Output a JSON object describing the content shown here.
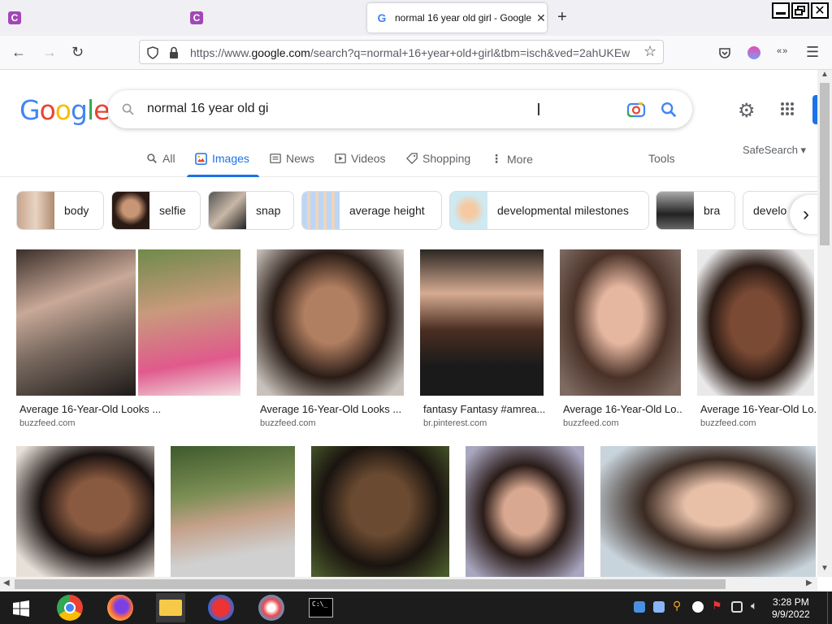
{
  "browser": {
    "tabs": [
      {
        "favicon": "C",
        "title": ""
      },
      {
        "favicon": "C",
        "title": ""
      },
      {
        "favicon": "G",
        "title": "normal 16 year old girl - Google"
      }
    ],
    "url_prefix": "https://www.",
    "url_domain": "google.com",
    "url_rest": "/search?q=normal+16+year+old+girl&tbm=isch&ved=2ahUKEw"
  },
  "google": {
    "logo": [
      "G",
      "o",
      "o",
      "g",
      "l",
      "e"
    ],
    "logo_colors": [
      "#4285f4",
      "#ea4335",
      "#fbbc05",
      "#4285f4",
      "#34a853",
      "#ea4335"
    ],
    "query": "normal 16 year old gi",
    "tabs": [
      "All",
      "Images",
      "News",
      "Videos",
      "Shopping",
      "More"
    ],
    "tools": "Tools",
    "safesearch": "SafeSearch",
    "chips": [
      "body",
      "selfie",
      "snap",
      "average height",
      "developmental milestones",
      "bra",
      "develo"
    ],
    "results": [
      {
        "caption": "Average 16-Year-Old Looks ...",
        "source": "buzzfeed.com"
      },
      {
        "caption": "Average 16-Year-Old Looks ...",
        "source": "buzzfeed.com"
      },
      {
        "caption": "fantasy Fantasy #amrea...",
        "source": "br.pinterest.com"
      },
      {
        "caption": "Average 16-Year-Old Lo...",
        "source": "buzzfeed.com"
      },
      {
        "caption": "Average 16-Year-Old Lo...",
        "source": "buzzfeed.com"
      }
    ]
  },
  "taskbar": {
    "time": "3:28 PM",
    "date": "9/9/2022"
  },
  "colors": {
    "accent": "#1a73e8",
    "tab_favicon": "#a346b8"
  }
}
